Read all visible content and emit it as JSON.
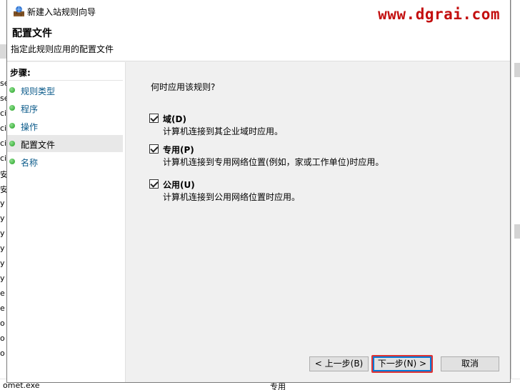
{
  "background": {
    "left_fragments": [
      "se",
      "se",
      "ci",
      "ci",
      "ci",
      "ci",
      "安",
      "安",
      "y",
      "y",
      "y",
      "y",
      "y",
      "y",
      "e",
      "e",
      "o",
      "o",
      "o"
    ],
    "bottom_row": {
      "name": "omet.exe",
      "type": "专用"
    }
  },
  "dialog": {
    "title": "新建入站规则向导",
    "watermark": "www.dgrai.com",
    "header": {
      "title": "配置文件",
      "subtitle": "指定此规则应用的配置文件"
    },
    "steps": {
      "label": "步骤:",
      "items": [
        {
          "label": "规则类型",
          "active": false
        },
        {
          "label": "程序",
          "active": false
        },
        {
          "label": "操作",
          "active": false
        },
        {
          "label": "配置文件",
          "active": true
        },
        {
          "label": "名称",
          "active": false
        }
      ]
    },
    "content": {
      "question": "何时应用该规则?",
      "options": [
        {
          "name": "域(D)",
          "desc": "计算机连接到其企业域时应用。",
          "checked": true
        },
        {
          "name": "专用(P)",
          "desc": "计算机连接到专用网络位置(例如，家或工作单位)时应用。",
          "checked": true
        },
        {
          "name": "公用(U)",
          "desc": "计算机连接到公用网络位置时应用。",
          "checked": true
        }
      ]
    },
    "buttons": {
      "back": "< 上一步(B)",
      "next": "下一步(N) >",
      "cancel": "取消"
    }
  },
  "colors": {
    "watermark": "#c30f0f",
    "step_link": "#0a5a8a",
    "highlight": "#e03434",
    "primary_border": "#0078d7"
  }
}
